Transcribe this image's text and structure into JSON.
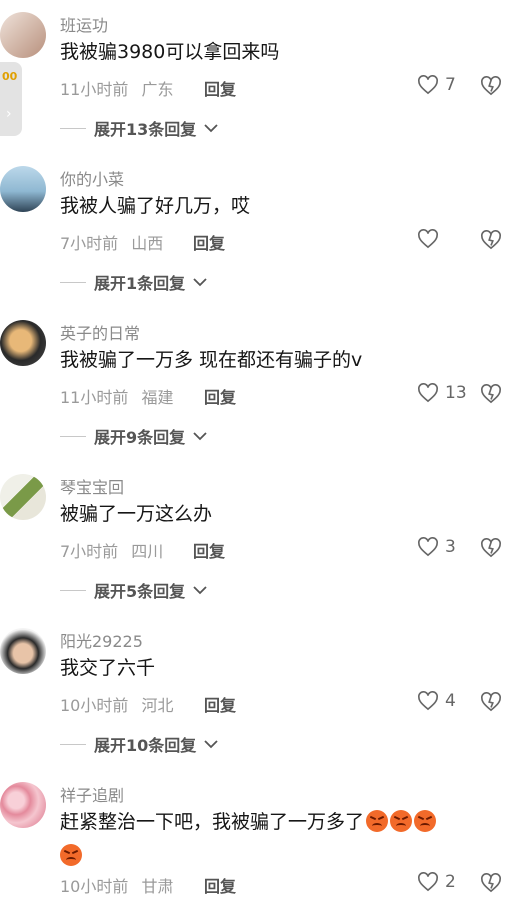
{
  "side_tab": {
    "badge": "00",
    "arrow": "›"
  },
  "comments": [
    {
      "username": "班运功",
      "text": "我被骗3980可以拿回来吗",
      "time": "11小时前",
      "region": "广东",
      "reply_label": "回复",
      "likes": "7",
      "expand_label": "展开13条回复",
      "avatar_colors": [
        "#e8d8cf",
        "#b38e7c"
      ]
    },
    {
      "username": "你的小菜",
      "text": "我被人骗了好几万，哎",
      "time": "7小时前",
      "region": "山西",
      "reply_label": "回复",
      "likes": "",
      "expand_label": "展开1条回复",
      "avatar_colors": [
        "#9fc6dd",
        "#2c3e50"
      ]
    },
    {
      "username": "英子的日常",
      "text": "我被骗了一万多  现在都还有骗子的v",
      "time": "11小时前",
      "region": "福建",
      "reply_label": "回复",
      "likes": "13",
      "expand_label": "展开9条回复",
      "avatar_colors": [
        "#3b3b3b",
        "#e2b36a"
      ]
    },
    {
      "username": "琴宝宝回",
      "text": "被骗了一万这么办",
      "time": "7小时前",
      "region": "四川",
      "reply_label": "回复",
      "likes": "3",
      "expand_label": "展开5条回复",
      "avatar_colors": [
        "#e9eadf",
        "#6a8a3a"
      ]
    },
    {
      "username": "阳光29225",
      "text": "我交了六千",
      "time": "10小时前",
      "region": "河北",
      "reply_label": "回复",
      "likes": "4",
      "expand_label": "展开10条回复",
      "avatar_colors": [
        "#f2f2f2",
        "#3a3a3a"
      ]
    },
    {
      "username": "祥子追剧",
      "text": "赶紧整治一下吧，我被骗了一万多了",
      "time": "10小时前",
      "region": "甘肃",
      "reply_label": "回复",
      "likes": "2",
      "expand_label": "",
      "avatar_colors": [
        "#f5c6cf",
        "#e07a8c"
      ]
    }
  ]
}
